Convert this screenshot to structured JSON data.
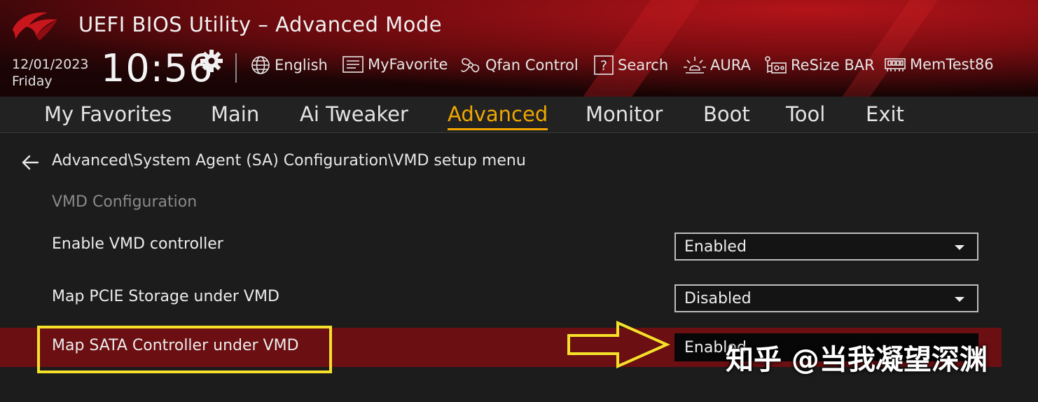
{
  "header": {
    "title": "UEFI BIOS Utility – Advanced Mode",
    "date": "12/01/2023",
    "day": "Friday",
    "time": "10:56",
    "toolbar": [
      {
        "label": "English",
        "icon": "globe-icon"
      },
      {
        "label": "MyFavorite",
        "icon": "favorite-list-icon"
      },
      {
        "label": "Qfan Control",
        "icon": "fan-icon"
      },
      {
        "label": "Search",
        "icon": "search-help-icon"
      },
      {
        "label": "AURA",
        "icon": "aura-light-icon"
      },
      {
        "label": "ReSize BAR",
        "icon": "resize-bar-icon"
      },
      {
        "label": "MemTest86",
        "icon": "memory-module-icon"
      }
    ]
  },
  "menu": {
    "items": [
      "My Favorites",
      "Main",
      "Ai Tweaker",
      "Advanced",
      "Monitor",
      "Boot",
      "Tool",
      "Exit"
    ],
    "active": "Advanced"
  },
  "content": {
    "breadcrumb": "Advanced\\System Agent (SA) Configuration\\VMD setup menu",
    "section": "VMD Configuration",
    "settings": [
      {
        "label": "Enable VMD controller",
        "value": "Enabled"
      },
      {
        "label": "Map PCIE Storage under VMD",
        "value": "Disabled"
      },
      {
        "label": "Map SATA Controller under VMD",
        "value": "Enabled"
      }
    ]
  },
  "watermark": "知乎 @当我凝望深渊",
  "colors": {
    "accent": "#f0a800",
    "highlight_row": "#6b0f12",
    "annotation": "#f5e12a"
  }
}
